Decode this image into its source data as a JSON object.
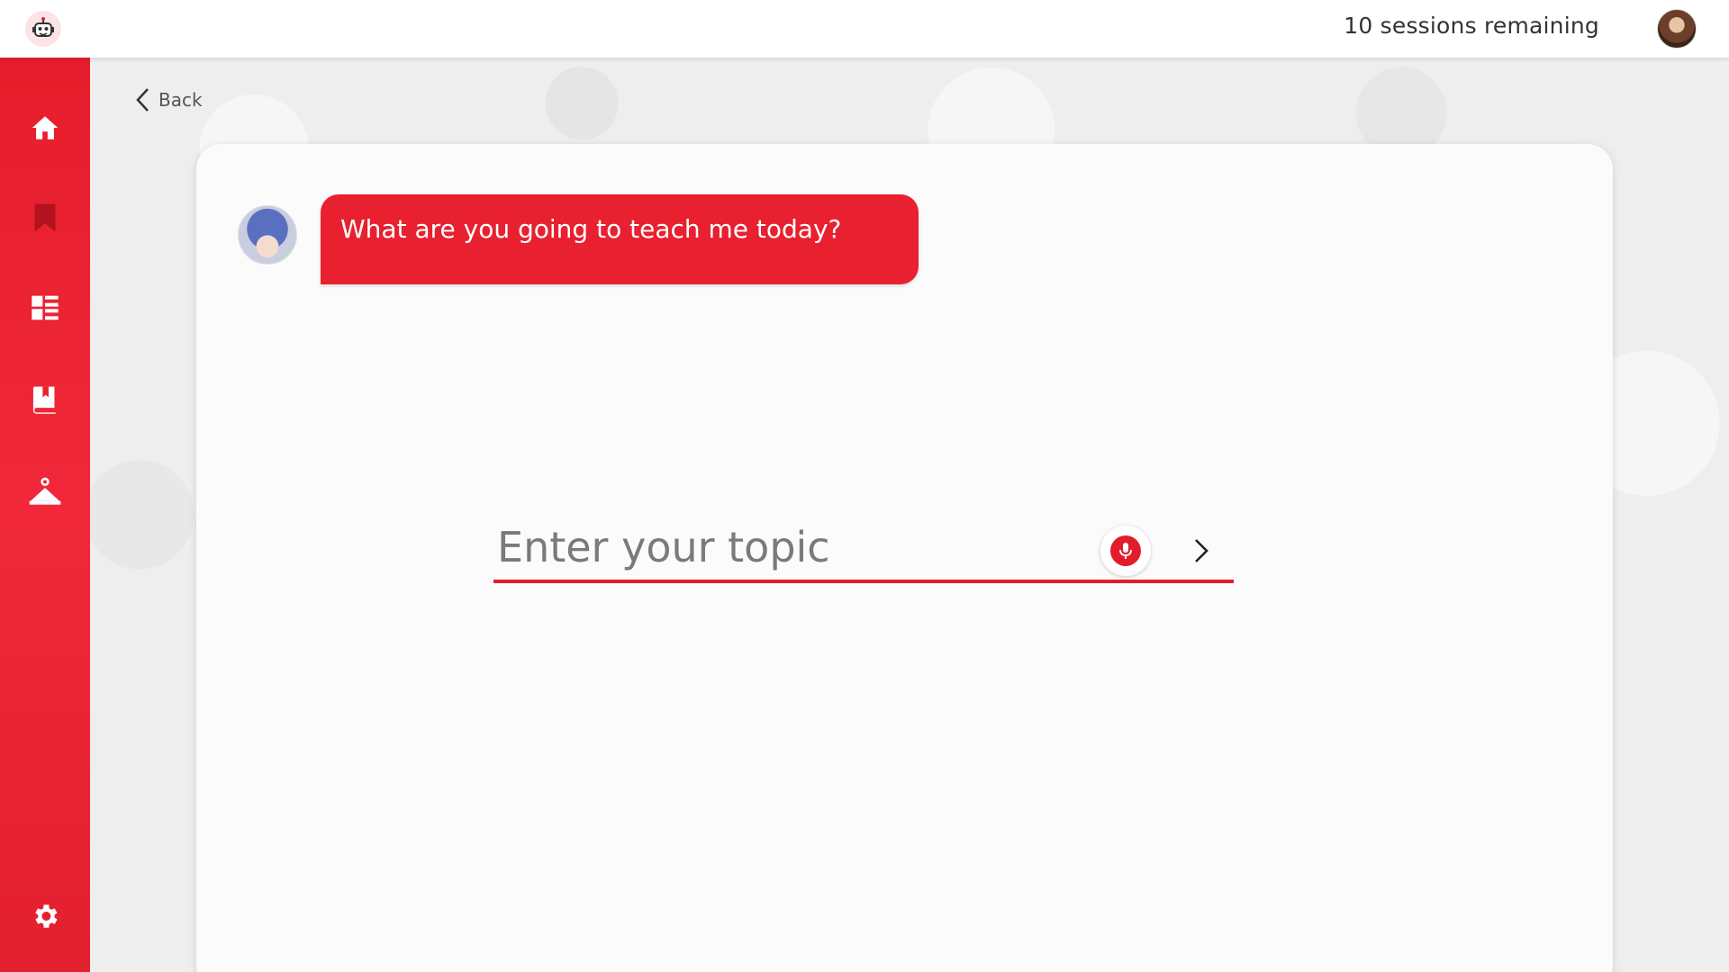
{
  "header": {
    "logo_icon": "robot-mascot-icon",
    "sessions_text": "10 sessions remaining",
    "user_avatar": "user-avatar"
  },
  "sidebar": {
    "items": [
      {
        "icon": "home-icon"
      },
      {
        "icon": "bookmark-icon"
      },
      {
        "icon": "dashboard-list-icon"
      },
      {
        "icon": "book-icon"
      },
      {
        "icon": "hanger-icon"
      }
    ],
    "settings_icon": "gear-icon",
    "color": "#e8202f"
  },
  "back": {
    "label": "Back"
  },
  "chat": {
    "bot_message": "What are you going to teach me today?",
    "bubble_color": "#e8202f"
  },
  "topic": {
    "placeholder": "Enter your topic",
    "value": ""
  }
}
